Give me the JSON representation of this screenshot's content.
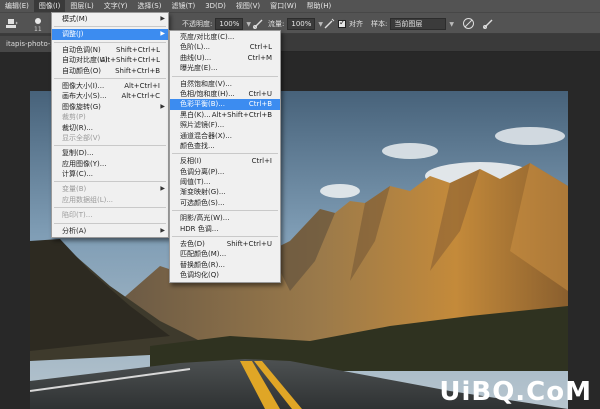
{
  "menubar": {
    "items": [
      "编辑(E)",
      "图像(I)",
      "图层(L)",
      "文字(Y)",
      "选择(S)",
      "滤镜(T)",
      "3D(D)",
      "视图(V)",
      "窗口(W)",
      "帮助(H)"
    ],
    "active_index": 1
  },
  "options": {
    "brush_size": "11",
    "opacity_label": "不透明度:",
    "opacity_value": "100%",
    "flow_label": "流量:",
    "flow_value": "100%",
    "align_label": "对齐",
    "sample_label": "样本:",
    "sample_value": "当前图层"
  },
  "document_tab": "itapis-photo-25",
  "image_menu": {
    "items": [
      {
        "label": "模式(M)",
        "shortcut": "",
        "submenu": true,
        "disabled": false,
        "highlight": false
      },
      {
        "sep": true
      },
      {
        "label": "调整(J)",
        "shortcut": "",
        "submenu": true,
        "disabled": false,
        "highlight": true
      },
      {
        "sep": true
      },
      {
        "label": "自动色调(N)",
        "shortcut": "Shift+Ctrl+L",
        "submenu": false,
        "disabled": false,
        "highlight": false
      },
      {
        "label": "自动对比度(U)",
        "shortcut": "Alt+Shift+Ctrl+L",
        "submenu": false,
        "disabled": false,
        "highlight": false
      },
      {
        "label": "自动颜色(O)",
        "shortcut": "Shift+Ctrl+B",
        "submenu": false,
        "disabled": false,
        "highlight": false
      },
      {
        "sep": true
      },
      {
        "label": "图像大小(I)...",
        "shortcut": "Alt+Ctrl+I",
        "submenu": false,
        "disabled": false,
        "highlight": false
      },
      {
        "label": "画布大小(S)...",
        "shortcut": "Alt+Ctrl+C",
        "submenu": false,
        "disabled": false,
        "highlight": false
      },
      {
        "label": "图像旋转(G)",
        "shortcut": "",
        "submenu": true,
        "disabled": false,
        "highlight": false
      },
      {
        "label": "裁剪(P)",
        "shortcut": "",
        "submenu": false,
        "disabled": true,
        "highlight": false
      },
      {
        "label": "裁切(R)...",
        "shortcut": "",
        "submenu": false,
        "disabled": false,
        "highlight": false
      },
      {
        "label": "显示全部(V)",
        "shortcut": "",
        "submenu": false,
        "disabled": true,
        "highlight": false
      },
      {
        "sep": true
      },
      {
        "label": "复制(D)...",
        "shortcut": "",
        "submenu": false,
        "disabled": false,
        "highlight": false
      },
      {
        "label": "应用图像(Y)...",
        "shortcut": "",
        "submenu": false,
        "disabled": false,
        "highlight": false
      },
      {
        "label": "计算(C)...",
        "shortcut": "",
        "submenu": false,
        "disabled": false,
        "highlight": false
      },
      {
        "sep": true
      },
      {
        "label": "变量(B)",
        "shortcut": "",
        "submenu": true,
        "disabled": true,
        "highlight": false
      },
      {
        "label": "应用数据组(L)...",
        "shortcut": "",
        "submenu": false,
        "disabled": true,
        "highlight": false
      },
      {
        "sep": true
      },
      {
        "label": "陷印(T)...",
        "shortcut": "",
        "submenu": false,
        "disabled": true,
        "highlight": false
      },
      {
        "sep": true
      },
      {
        "label": "分析(A)",
        "shortcut": "",
        "submenu": true,
        "disabled": false,
        "highlight": false
      }
    ]
  },
  "adjust_menu": {
    "items": [
      {
        "label": "亮度/对比度(C)...",
        "shortcut": "",
        "highlight": false
      },
      {
        "label": "色阶(L)...",
        "shortcut": "Ctrl+L",
        "highlight": false
      },
      {
        "label": "曲线(U)...",
        "shortcut": "Ctrl+M",
        "highlight": false
      },
      {
        "label": "曝光度(E)...",
        "shortcut": "",
        "highlight": false
      },
      {
        "sep": true
      },
      {
        "label": "自然饱和度(V)...",
        "shortcut": "",
        "highlight": false
      },
      {
        "label": "色相/饱和度(H)...",
        "shortcut": "Ctrl+U",
        "highlight": false
      },
      {
        "label": "色彩平衡(B)...",
        "shortcut": "Ctrl+B",
        "highlight": true
      },
      {
        "label": "黑白(K)...",
        "shortcut": "Alt+Shift+Ctrl+B",
        "highlight": false
      },
      {
        "label": "照片滤镜(F)...",
        "shortcut": "",
        "highlight": false
      },
      {
        "label": "通道混合器(X)...",
        "shortcut": "",
        "highlight": false
      },
      {
        "label": "颜色查找...",
        "shortcut": "",
        "highlight": false
      },
      {
        "sep": true
      },
      {
        "label": "反相(I)",
        "shortcut": "Ctrl+I",
        "highlight": false
      },
      {
        "label": "色调分离(P)...",
        "shortcut": "",
        "highlight": false
      },
      {
        "label": "阈值(T)...",
        "shortcut": "",
        "highlight": false
      },
      {
        "label": "渐变映射(G)...",
        "shortcut": "",
        "highlight": false
      },
      {
        "label": "可选颜色(S)...",
        "shortcut": "",
        "highlight": false
      },
      {
        "sep": true
      },
      {
        "label": "阴影/高光(W)...",
        "shortcut": "",
        "highlight": false
      },
      {
        "label": "HDR 色调...",
        "shortcut": "",
        "highlight": false
      },
      {
        "sep": true
      },
      {
        "label": "去色(D)",
        "shortcut": "Shift+Ctrl+U",
        "highlight": false
      },
      {
        "label": "匹配颜色(M)...",
        "shortcut": "",
        "highlight": false
      },
      {
        "label": "替换颜色(R)...",
        "shortcut": "",
        "highlight": false
      },
      {
        "label": "色调均化(Q)",
        "shortcut": "",
        "highlight": false
      }
    ]
  },
  "watermark": "UiBQ.CoM",
  "colors": {
    "highlight": "#3c8cf0",
    "menu_bg": "#f0f0f0",
    "chrome": "#535353"
  }
}
